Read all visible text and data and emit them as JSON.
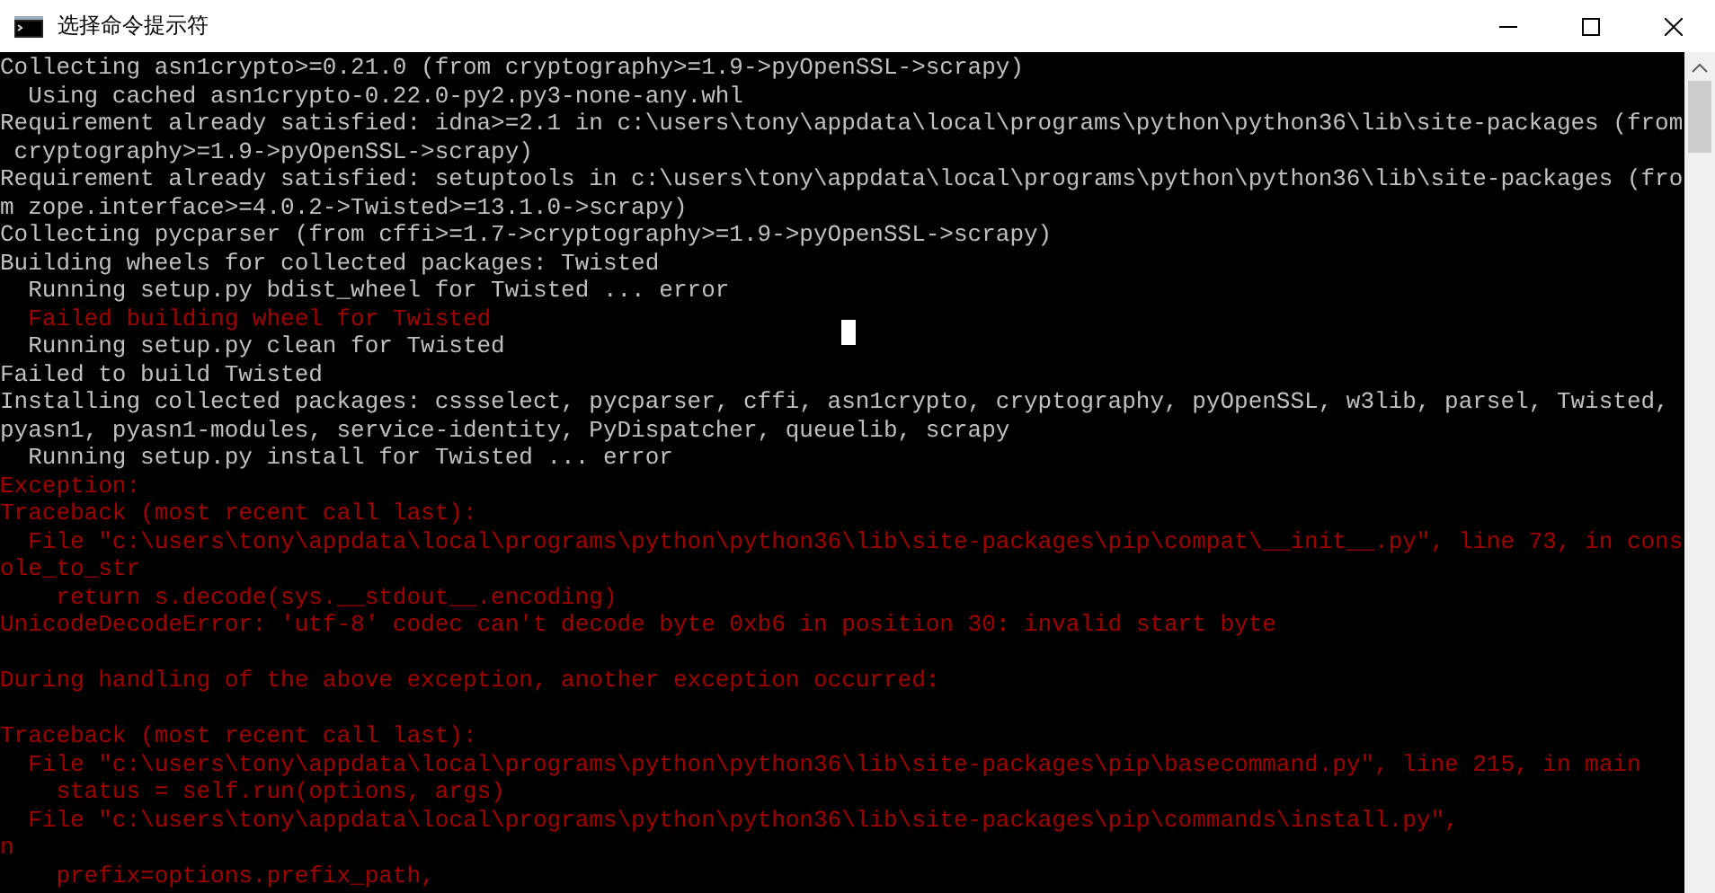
{
  "window": {
    "title": "选择命令提示符"
  },
  "console": {
    "lines": [
      {
        "kind": "normal",
        "text": "Collecting asn1crypto>=0.21.0 (from cryptography>=1.9->pyOpenSSL->scrapy)"
      },
      {
        "kind": "normal",
        "text": "  Using cached asn1crypto-0.22.0-py2.py3-none-any.whl"
      },
      {
        "kind": "normal",
        "text": "Requirement already satisfied: idna>=2.1 in c:\\users\\tony\\appdata\\local\\programs\\python\\python36\\lib\\site-packages (from"
      },
      {
        "kind": "normal",
        "text": " cryptography>=1.9->pyOpenSSL->scrapy)"
      },
      {
        "kind": "normal",
        "text": "Requirement already satisfied: setuptools in c:\\users\\tony\\appdata\\local\\programs\\python\\python36\\lib\\site-packages (fro"
      },
      {
        "kind": "normal",
        "text": "m zope.interface>=4.0.2->Twisted>=13.1.0->scrapy)"
      },
      {
        "kind": "normal",
        "text": "Collecting pycparser (from cffi>=1.7->cryptography>=1.9->pyOpenSSL->scrapy)"
      },
      {
        "kind": "normal",
        "text": "Building wheels for collected packages: Twisted"
      },
      {
        "kind": "normal",
        "text": "  Running setup.py bdist_wheel for Twisted ... error"
      },
      {
        "kind": "error",
        "text": "  Failed building wheel for Twisted"
      },
      {
        "kind": "normal",
        "text": "  Running setup.py clean for Twisted",
        "cursor": true
      },
      {
        "kind": "normal",
        "text": "Failed to build Twisted"
      },
      {
        "kind": "normal",
        "text": "Installing collected packages: cssselect, pycparser, cffi, asn1crypto, cryptography, pyOpenSSL, w3lib, parsel, Twisted,"
      },
      {
        "kind": "normal",
        "text": "pyasn1, pyasn1-modules, service-identity, PyDispatcher, queuelib, scrapy"
      },
      {
        "kind": "normal",
        "text": "  Running setup.py install for Twisted ... error"
      },
      {
        "kind": "error",
        "text": "Exception:"
      },
      {
        "kind": "error",
        "text": "Traceback (most recent call last):"
      },
      {
        "kind": "error",
        "text": "  File \"c:\\users\\tony\\appdata\\local\\programs\\python\\python36\\lib\\site-packages\\pip\\compat\\__init__.py\", line 73, in cons"
      },
      {
        "kind": "error",
        "text": "ole_to_str"
      },
      {
        "kind": "error",
        "text": "    return s.decode(sys.__stdout__.encoding)"
      },
      {
        "kind": "error",
        "text": "UnicodeDecodeError: 'utf-8' codec can't decode byte 0xb6 in position 30: invalid start byte"
      },
      {
        "kind": "blank"
      },
      {
        "kind": "error",
        "text": "During handling of the above exception, another exception occurred:"
      },
      {
        "kind": "blank"
      },
      {
        "kind": "error",
        "text": "Traceback (most recent call last):"
      },
      {
        "kind": "error",
        "text": "  File \"c:\\users\\tony\\appdata\\local\\programs\\python\\python36\\lib\\site-packages\\pip\\basecommand.py\", line 215, in main"
      },
      {
        "kind": "error",
        "text": "    status = self.run(options, args)"
      },
      {
        "kind": "error",
        "text": "  File \"c:\\users\\tony\\appdata\\local\\programs\\python\\python36\\lib\\site-packages\\pip\\commands\\install.py\","
      },
      {
        "kind": "error",
        "text": "n"
      },
      {
        "kind": "error",
        "text": "    prefix=options.prefix_path,"
      }
    ]
  }
}
